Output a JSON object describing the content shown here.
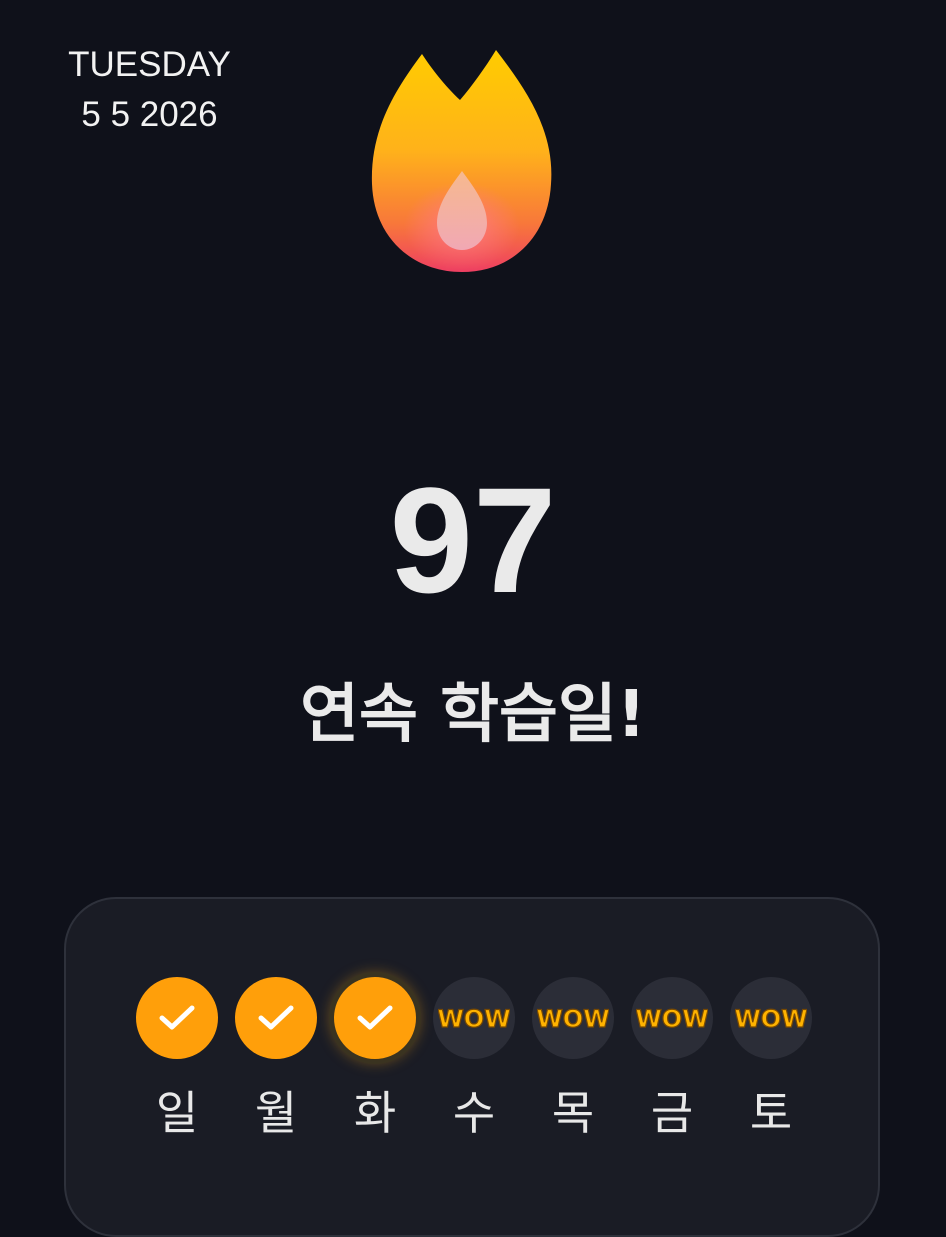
{
  "date": {
    "weekday": "TUESDAY",
    "date_text": "5 5 2026"
  },
  "streak": {
    "icon": "flame-icon",
    "count": "97",
    "label": "연속 학습일!"
  },
  "week": {
    "check_color": "#ff9f0a",
    "pending_color": "#2b2d37",
    "days": [
      {
        "label": "일",
        "status": "done",
        "icon": "check-icon"
      },
      {
        "label": "월",
        "status": "done",
        "icon": "check-icon"
      },
      {
        "label": "화",
        "status": "done",
        "icon": "check-icon"
      },
      {
        "label": "수",
        "status": "pending",
        "icon": "wow-icon",
        "icon_text": "WOW"
      },
      {
        "label": "목",
        "status": "pending",
        "icon": "wow-icon",
        "icon_text": "WOW"
      },
      {
        "label": "금",
        "status": "pending",
        "icon": "wow-icon",
        "icon_text": "WOW"
      },
      {
        "label": "토",
        "status": "pending",
        "icon": "wow-icon",
        "icon_text": "WOW"
      }
    ]
  },
  "colors": {
    "background": "#0f111a",
    "card": "#1a1c25",
    "flame_top": "#ffc400",
    "flame_bottom": "#f24a5a",
    "accent": "#ff9f0a"
  }
}
